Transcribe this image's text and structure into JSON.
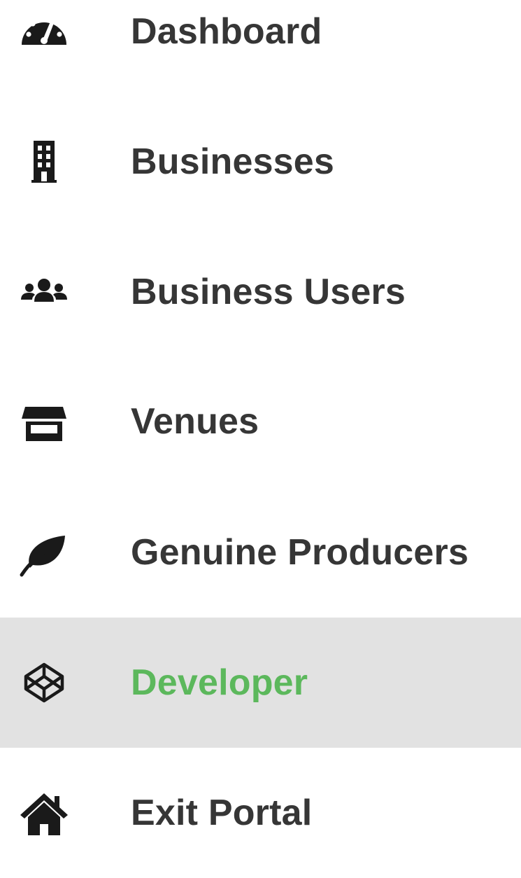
{
  "sidebar": {
    "items": [
      {
        "label": "Dashboard",
        "icon": "dashboard-gauge-icon",
        "active": false
      },
      {
        "label": "Businesses",
        "icon": "building-icon",
        "active": false
      },
      {
        "label": "Business Users",
        "icon": "users-icon",
        "active": false
      },
      {
        "label": "Venues",
        "icon": "store-icon",
        "active": false
      },
      {
        "label": "Genuine Producers",
        "icon": "leaf-icon",
        "active": false
      },
      {
        "label": "Developer",
        "icon": "codepen-icon",
        "active": true
      },
      {
        "label": "Exit Portal",
        "icon": "home-icon",
        "active": false
      }
    ]
  },
  "colors": {
    "text": "#363636",
    "active_text": "#5cb85c",
    "active_background": "#e2e2e2",
    "icon": "#1a1a1a"
  }
}
